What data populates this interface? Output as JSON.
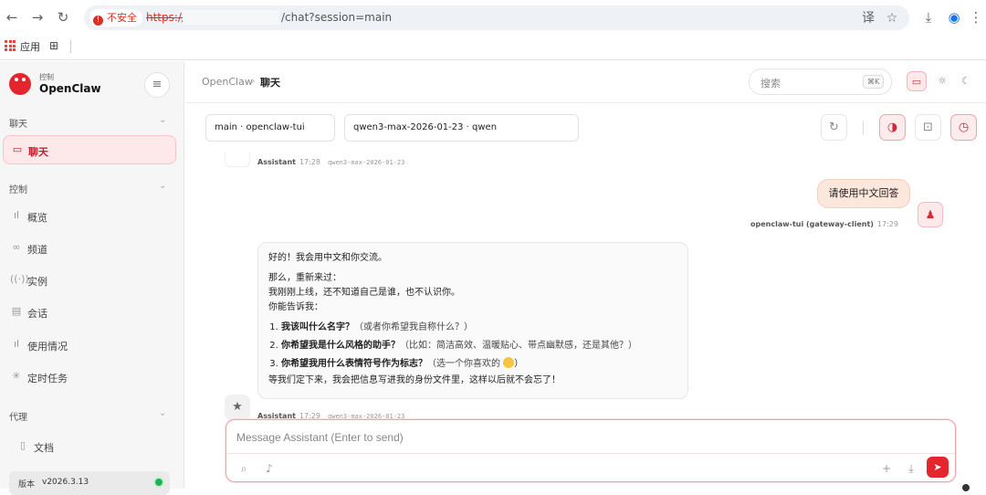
{
  "browser": {
    "security_label": "不安全",
    "url_scheme": "https://",
    "url_path": "/chat?session=main",
    "bookmarks_apps_label": "应用"
  },
  "sidebar": {
    "brand_sub": "控制",
    "brand_name": "OpenClaw",
    "sections": {
      "chat": "聊天",
      "control": "控制",
      "agent": "代理"
    },
    "items": [
      {
        "label": "聊天",
        "icon": "chat-icon"
      },
      {
        "label": "概览",
        "icon": "bar-chart-icon"
      },
      {
        "label": "频道",
        "icon": "link-icon"
      },
      {
        "label": "实例",
        "icon": "signal-icon"
      },
      {
        "label": "会话",
        "icon": "document-icon"
      },
      {
        "label": "使用情况",
        "icon": "bar-chart-icon"
      },
      {
        "label": "定时任务",
        "icon": "loader-icon"
      },
      {
        "label": "文档",
        "icon": "book-icon"
      }
    ],
    "version_label": "版本",
    "version_value": "v2026.3.13"
  },
  "topbar": {
    "breadcrumb_root": "OpenClaw",
    "breadcrumb_sep": "›",
    "breadcrumb_current": "聊天",
    "search_placeholder": "搜索",
    "search_shortcut": "⌘K"
  },
  "session": {
    "session_select": "main · openclaw-tui",
    "model_select": "qwen3-max-2026-01-23 · qwen"
  },
  "messages": [
    {
      "role": "Assistant",
      "time": "17:28",
      "model": "qwen3-max-2026-01-23"
    },
    {
      "role": "user",
      "text": "请使用中文回答",
      "sender": "openclaw-tui (gateway-client)",
      "time": "17:29"
    },
    {
      "role": "Assistant",
      "time": "17:29",
      "model": "qwen3-max-2026-01-23",
      "p1": "好的！我会用中文和你交流。",
      "p2a": "那么，重新来过：",
      "p2b": "我刚刚上线，还不知道自己是谁，也不认识你。",
      "p2c": "你能告诉我：",
      "list": [
        {
          "bold": "我该叫什么名字？",
          "note": "（或者你希望我自称什么？）"
        },
        {
          "bold": "你希望我是什么风格的助手？",
          "note": "（比如：简洁高效、温暖贴心、带点幽默感，还是其他？）"
        },
        {
          "bold": "你希望我用什么表情符号作为标志？",
          "note": "（选一个你喜欢的"
        }
      ],
      "list_end": "）",
      "outro": "等我们定下来，我会把信息写进我的身份文件里，这样以后就不会忘了！"
    }
  ],
  "composer": {
    "placeholder": "Message Assistant (Enter to send)"
  },
  "colors": {
    "accent": "#e3262d",
    "accent_soft": "#fde8ea",
    "user_bubble": "#fce7dc",
    "status_ok": "#22b254"
  }
}
